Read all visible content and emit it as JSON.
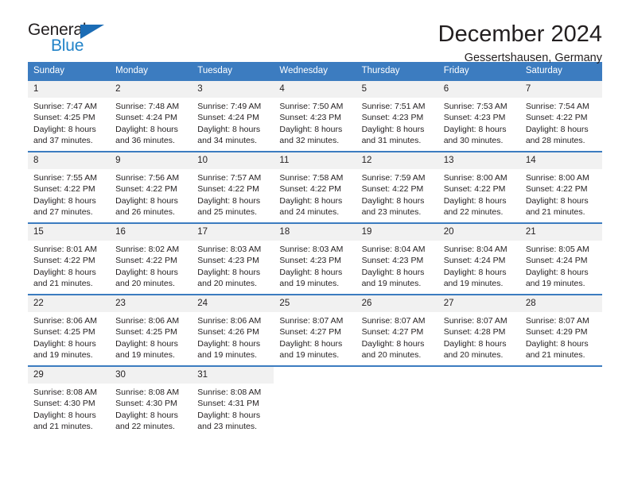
{
  "brand": {
    "name_part1": "General",
    "name_part2": "Blue",
    "triangle_color": "#1b6cb5",
    "blue_color": "#2283c8"
  },
  "header": {
    "title": "December 2024",
    "subtitle": "Gessertshausen, Germany",
    "header_bg": "#3c7cc0",
    "daynum_bg": "#f1f1f1"
  },
  "weekdays": [
    "Sunday",
    "Monday",
    "Tuesday",
    "Wednesday",
    "Thursday",
    "Friday",
    "Saturday"
  ],
  "labels": {
    "sunrise_prefix": "Sunrise:",
    "sunset_prefix": "Sunset:",
    "daylight_prefix": "Daylight:"
  },
  "weeks": [
    [
      {
        "day": "1",
        "sunrise": "Sunrise: 7:47 AM",
        "sunset": "Sunset: 4:25 PM",
        "daylight1": "Daylight: 8 hours",
        "daylight2": "and 37 minutes."
      },
      {
        "day": "2",
        "sunrise": "Sunrise: 7:48 AM",
        "sunset": "Sunset: 4:24 PM",
        "daylight1": "Daylight: 8 hours",
        "daylight2": "and 36 minutes."
      },
      {
        "day": "3",
        "sunrise": "Sunrise: 7:49 AM",
        "sunset": "Sunset: 4:24 PM",
        "daylight1": "Daylight: 8 hours",
        "daylight2": "and 34 minutes."
      },
      {
        "day": "4",
        "sunrise": "Sunrise: 7:50 AM",
        "sunset": "Sunset: 4:23 PM",
        "daylight1": "Daylight: 8 hours",
        "daylight2": "and 32 minutes."
      },
      {
        "day": "5",
        "sunrise": "Sunrise: 7:51 AM",
        "sunset": "Sunset: 4:23 PM",
        "daylight1": "Daylight: 8 hours",
        "daylight2": "and 31 minutes."
      },
      {
        "day": "6",
        "sunrise": "Sunrise: 7:53 AM",
        "sunset": "Sunset: 4:23 PM",
        "daylight1": "Daylight: 8 hours",
        "daylight2": "and 30 minutes."
      },
      {
        "day": "7",
        "sunrise": "Sunrise: 7:54 AM",
        "sunset": "Sunset: 4:22 PM",
        "daylight1": "Daylight: 8 hours",
        "daylight2": "and 28 minutes."
      }
    ],
    [
      {
        "day": "8",
        "sunrise": "Sunrise: 7:55 AM",
        "sunset": "Sunset: 4:22 PM",
        "daylight1": "Daylight: 8 hours",
        "daylight2": "and 27 minutes."
      },
      {
        "day": "9",
        "sunrise": "Sunrise: 7:56 AM",
        "sunset": "Sunset: 4:22 PM",
        "daylight1": "Daylight: 8 hours",
        "daylight2": "and 26 minutes."
      },
      {
        "day": "10",
        "sunrise": "Sunrise: 7:57 AM",
        "sunset": "Sunset: 4:22 PM",
        "daylight1": "Daylight: 8 hours",
        "daylight2": "and 25 minutes."
      },
      {
        "day": "11",
        "sunrise": "Sunrise: 7:58 AM",
        "sunset": "Sunset: 4:22 PM",
        "daylight1": "Daylight: 8 hours",
        "daylight2": "and 24 minutes."
      },
      {
        "day": "12",
        "sunrise": "Sunrise: 7:59 AM",
        "sunset": "Sunset: 4:22 PM",
        "daylight1": "Daylight: 8 hours",
        "daylight2": "and 23 minutes."
      },
      {
        "day": "13",
        "sunrise": "Sunrise: 8:00 AM",
        "sunset": "Sunset: 4:22 PM",
        "daylight1": "Daylight: 8 hours",
        "daylight2": "and 22 minutes."
      },
      {
        "day": "14",
        "sunrise": "Sunrise: 8:00 AM",
        "sunset": "Sunset: 4:22 PM",
        "daylight1": "Daylight: 8 hours",
        "daylight2": "and 21 minutes."
      }
    ],
    [
      {
        "day": "15",
        "sunrise": "Sunrise: 8:01 AM",
        "sunset": "Sunset: 4:22 PM",
        "daylight1": "Daylight: 8 hours",
        "daylight2": "and 21 minutes."
      },
      {
        "day": "16",
        "sunrise": "Sunrise: 8:02 AM",
        "sunset": "Sunset: 4:22 PM",
        "daylight1": "Daylight: 8 hours",
        "daylight2": "and 20 minutes."
      },
      {
        "day": "17",
        "sunrise": "Sunrise: 8:03 AM",
        "sunset": "Sunset: 4:23 PM",
        "daylight1": "Daylight: 8 hours",
        "daylight2": "and 20 minutes."
      },
      {
        "day": "18",
        "sunrise": "Sunrise: 8:03 AM",
        "sunset": "Sunset: 4:23 PM",
        "daylight1": "Daylight: 8 hours",
        "daylight2": "and 19 minutes."
      },
      {
        "day": "19",
        "sunrise": "Sunrise: 8:04 AM",
        "sunset": "Sunset: 4:23 PM",
        "daylight1": "Daylight: 8 hours",
        "daylight2": "and 19 minutes."
      },
      {
        "day": "20",
        "sunrise": "Sunrise: 8:04 AM",
        "sunset": "Sunset: 4:24 PM",
        "daylight1": "Daylight: 8 hours",
        "daylight2": "and 19 minutes."
      },
      {
        "day": "21",
        "sunrise": "Sunrise: 8:05 AM",
        "sunset": "Sunset: 4:24 PM",
        "daylight1": "Daylight: 8 hours",
        "daylight2": "and 19 minutes."
      }
    ],
    [
      {
        "day": "22",
        "sunrise": "Sunrise: 8:06 AM",
        "sunset": "Sunset: 4:25 PM",
        "daylight1": "Daylight: 8 hours",
        "daylight2": "and 19 minutes."
      },
      {
        "day": "23",
        "sunrise": "Sunrise: 8:06 AM",
        "sunset": "Sunset: 4:25 PM",
        "daylight1": "Daylight: 8 hours",
        "daylight2": "and 19 minutes."
      },
      {
        "day": "24",
        "sunrise": "Sunrise: 8:06 AM",
        "sunset": "Sunset: 4:26 PM",
        "daylight1": "Daylight: 8 hours",
        "daylight2": "and 19 minutes."
      },
      {
        "day": "25",
        "sunrise": "Sunrise: 8:07 AM",
        "sunset": "Sunset: 4:27 PM",
        "daylight1": "Daylight: 8 hours",
        "daylight2": "and 19 minutes."
      },
      {
        "day": "26",
        "sunrise": "Sunrise: 8:07 AM",
        "sunset": "Sunset: 4:27 PM",
        "daylight1": "Daylight: 8 hours",
        "daylight2": "and 20 minutes."
      },
      {
        "day": "27",
        "sunrise": "Sunrise: 8:07 AM",
        "sunset": "Sunset: 4:28 PM",
        "daylight1": "Daylight: 8 hours",
        "daylight2": "and 20 minutes."
      },
      {
        "day": "28",
        "sunrise": "Sunrise: 8:07 AM",
        "sunset": "Sunset: 4:29 PM",
        "daylight1": "Daylight: 8 hours",
        "daylight2": "and 21 minutes."
      }
    ],
    [
      {
        "day": "29",
        "sunrise": "Sunrise: 8:08 AM",
        "sunset": "Sunset: 4:30 PM",
        "daylight1": "Daylight: 8 hours",
        "daylight2": "and 21 minutes."
      },
      {
        "day": "30",
        "sunrise": "Sunrise: 8:08 AM",
        "sunset": "Sunset: 4:30 PM",
        "daylight1": "Daylight: 8 hours",
        "daylight2": "and 22 minutes."
      },
      {
        "day": "31",
        "sunrise": "Sunrise: 8:08 AM",
        "sunset": "Sunset: 4:31 PM",
        "daylight1": "Daylight: 8 hours",
        "daylight2": "and 23 minutes."
      },
      {
        "day": "",
        "sunrise": "",
        "sunset": "",
        "daylight1": "",
        "daylight2": ""
      },
      {
        "day": "",
        "sunrise": "",
        "sunset": "",
        "daylight1": "",
        "daylight2": ""
      },
      {
        "day": "",
        "sunrise": "",
        "sunset": "",
        "daylight1": "",
        "daylight2": ""
      },
      {
        "day": "",
        "sunrise": "",
        "sunset": "",
        "daylight1": "",
        "daylight2": ""
      }
    ]
  ]
}
